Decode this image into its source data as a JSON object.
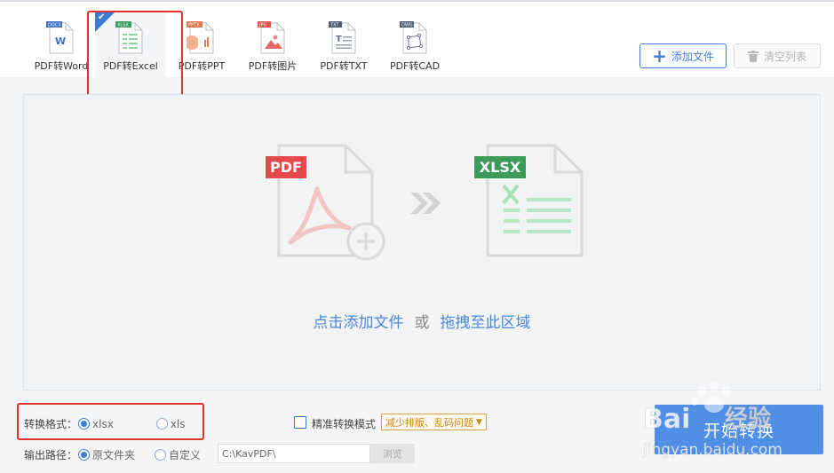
{
  "tabs": [
    {
      "label": "PDF转Word",
      "badge": "DOCX",
      "color": "#3f6fbf",
      "active": false
    },
    {
      "label": "PDF转Excel",
      "badge": "XLSX",
      "color": "#3c9a5a",
      "active": true
    },
    {
      "label": "PDF转PPT",
      "badge": "PPTX",
      "color": "#e07a4a",
      "active": false
    },
    {
      "label": "PDF转图片",
      "badge": "JPG",
      "color": "#d9534f",
      "active": false
    },
    {
      "label": "PDF转TXT",
      "badge": "TXT",
      "color": "#4f5d73",
      "active": false
    },
    {
      "label": "PDF转CAD",
      "badge": "DWG",
      "color": "#4f5d73",
      "active": false
    }
  ],
  "toolbar": {
    "add_file_label": "添加文件",
    "clear_list_label": "清空列表"
  },
  "dropzone": {
    "source_badge": "PDF",
    "target_badge": "XLSX",
    "click_add_text": "点击添加文件",
    "or_text": "或",
    "drag_text": "拖拽至此区域"
  },
  "options": {
    "format_label": "转换格式：",
    "format_options": [
      "xlsx",
      "xls"
    ],
    "format_selected": "xlsx",
    "precise_mode_label": "精准转换模式",
    "precise_tip": "减少排版、乱码问题",
    "output_label": "输出路径：",
    "output_options": [
      "原文件夹",
      "自定义"
    ],
    "output_selected": "原文件夹",
    "path_value": "C:\\KavPDF\\",
    "browse_label": "浏览"
  },
  "start_button_label": "开始转换",
  "watermark": {
    "logo_text": "Bai",
    "logo_suffix": "经验",
    "url": "jingyan.baidu.com"
  },
  "colors": {
    "accent": "#3d7bd9",
    "link": "#4a88d6",
    "pdf_red": "#e5484d",
    "excel_green": "#3c9a5a",
    "highlight": "#e0312b"
  }
}
